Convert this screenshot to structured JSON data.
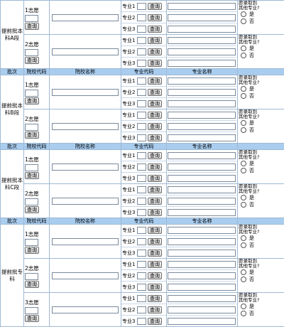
{
  "headers": {
    "batch": "批次",
    "school_code": "院校代码",
    "school_name": "院校名称",
    "major_code": "专业代码",
    "major_name": "专业名称"
  },
  "labels": {
    "query": "查询",
    "major_prefix": [
      "专业1",
      "专业2",
      "专业3"
    ],
    "adjust_question": "愿录取到其他专业?",
    "yes": "是",
    "no": "否"
  },
  "sections": [
    {
      "batch": "提前批本科A段",
      "wishes": [
        "1志愿",
        "2志愿"
      ]
    },
    {
      "batch": "提前批本科B段",
      "wishes": [
        "1志愿",
        "2志愿"
      ]
    },
    {
      "batch": "提前批本科C段",
      "wishes": [
        "1志愿",
        "2志愿"
      ]
    },
    {
      "batch": "提前批专科",
      "wishes": [
        "1志愿",
        "2志愿",
        "3志愿"
      ]
    }
  ]
}
